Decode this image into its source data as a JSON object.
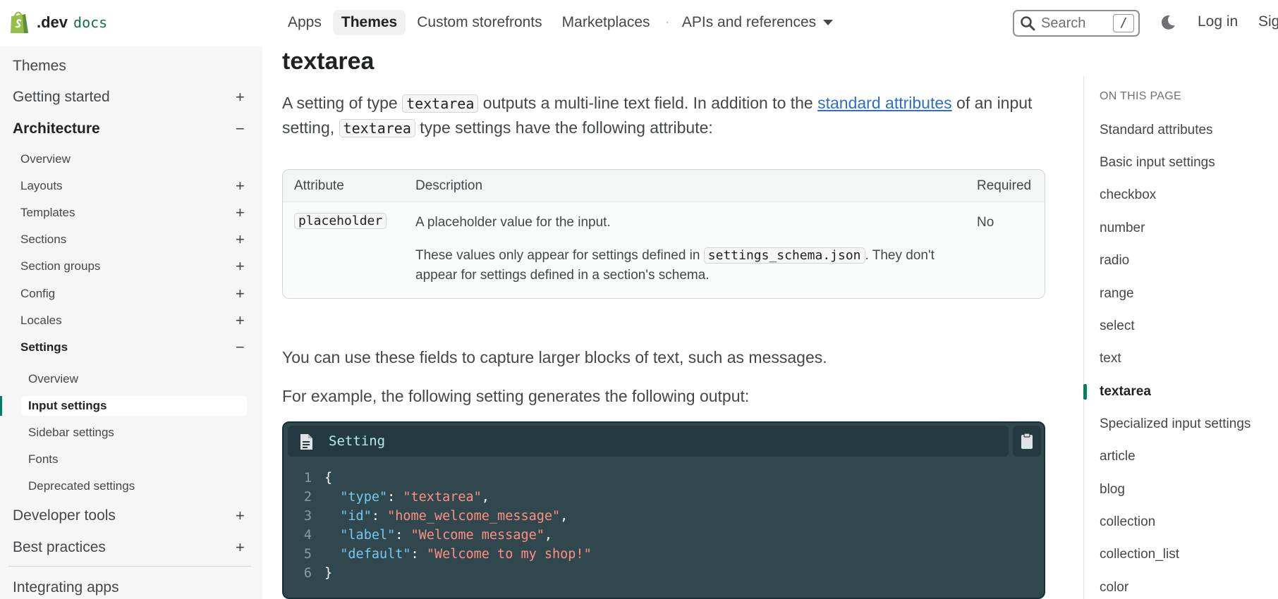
{
  "brand": {
    "dev": ".dev",
    "docs": "docs"
  },
  "nav": {
    "items": [
      "Apps",
      "Themes",
      "Custom storefronts",
      "Marketplaces"
    ],
    "dot": "·",
    "apis_label": "APIs and references",
    "active": "Themes"
  },
  "search": {
    "placeholder": "Search",
    "shortcut": "/"
  },
  "auth": {
    "login": "Log in",
    "signup": "Sig"
  },
  "sidebar": {
    "items": [
      {
        "label": "Themes",
        "level": 1,
        "sign": ""
      },
      {
        "label": "Getting started",
        "level": 1,
        "sign": "+"
      },
      {
        "label": "Architecture",
        "level": 1,
        "sign": "−",
        "bold": true
      },
      {
        "label": "Overview",
        "level": 2,
        "sign": ""
      },
      {
        "label": "Layouts",
        "level": 2,
        "sign": "+"
      },
      {
        "label": "Templates",
        "level": 2,
        "sign": "+"
      },
      {
        "label": "Sections",
        "level": 2,
        "sign": "+"
      },
      {
        "label": "Section groups",
        "level": 2,
        "sign": "+"
      },
      {
        "label": "Config",
        "level": 2,
        "sign": "+"
      },
      {
        "label": "Locales",
        "level": 2,
        "sign": "+"
      },
      {
        "label": "Settings",
        "level": 2,
        "sign": "−",
        "bold": true
      },
      {
        "label": "Overview",
        "level": 3,
        "sign": ""
      },
      {
        "label": "Input settings",
        "level": 3,
        "sign": "",
        "active": true
      },
      {
        "label": "Sidebar settings",
        "level": 3,
        "sign": ""
      },
      {
        "label": "Fonts",
        "level": 3,
        "sign": ""
      },
      {
        "label": "Deprecated settings",
        "level": 3,
        "sign": ""
      },
      {
        "label": "Developer tools",
        "level": 1,
        "sign": "+"
      },
      {
        "label": "Best practices",
        "level": 1,
        "sign": "+"
      },
      {
        "label": "Integrating apps",
        "level": 1,
        "sign": ""
      }
    ]
  },
  "main": {
    "title": "textarea",
    "intro": {
      "t1": "A setting of type ",
      "code1": "textarea",
      "t2": " outputs a multi-line text field. In addition to the ",
      "link": "standard attributes",
      "t3": " of an input setting, ",
      "code2": "textarea",
      "t4": " type settings have the following attribute:"
    },
    "table": {
      "headers": [
        "Attribute",
        "Description",
        "Required"
      ],
      "row": {
        "attribute": "placeholder",
        "description": "A placeholder value for the input.",
        "note_1": "These values only appear for settings defined in ",
        "note_code": "settings_schema.json",
        "note_2": ". They don't appear for settings defined in a section's schema.",
        "required": "No"
      }
    },
    "para2": "You can use these fields to capture larger blocks of text, such as messages.",
    "para3": "For example, the following setting generates the following output:",
    "code": {
      "title": "Setting",
      "lines": [
        {
          "n": "1",
          "open": "{"
        },
        {
          "n": "2",
          "key": "\"type\"",
          "val": "\"textarea\"",
          "comma": ","
        },
        {
          "n": "3",
          "key": "\"id\"",
          "val": "\"home_welcome_message\"",
          "comma": ","
        },
        {
          "n": "4",
          "key": "\"label\"",
          "val": "\"Welcome message\"",
          "comma": ","
        },
        {
          "n": "5",
          "key": "\"default\"",
          "val": "\"Welcome to my shop!\"",
          "comma": ""
        },
        {
          "n": "6",
          "open": "}"
        }
      ]
    }
  },
  "toc": {
    "title": "ON THIS PAGE",
    "items": [
      "Standard attributes",
      "Basic input settings",
      "checkbox",
      "number",
      "radio",
      "range",
      "select",
      "text",
      "textarea",
      "Specialized input settings",
      "article",
      "blog",
      "collection",
      "collection_list",
      "color"
    ],
    "active": "textarea"
  },
  "colors": {
    "accent": "#008060",
    "link": "#2c6ecb",
    "code_bg": "#30474d"
  }
}
